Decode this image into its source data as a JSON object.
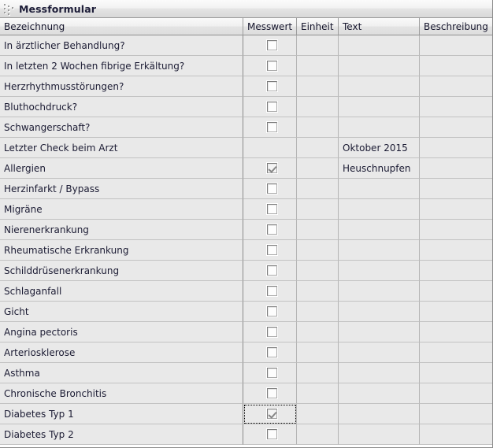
{
  "window": {
    "title": "Messformular",
    "grip_icon": "drag-grip-icon"
  },
  "colors": {
    "row_gray": "#e9e9e9",
    "row_white": "#ffffff",
    "focus_cell": "#fae3a6",
    "header_grad_top": "#fafafa",
    "header_grad_bottom": "#dedede",
    "border": "#b4b4b4"
  },
  "table": {
    "columns": [
      {
        "key": "bezeichnung",
        "label": "Bezeichnung"
      },
      {
        "key": "messwert",
        "label": "Messwert"
      },
      {
        "key": "einheit",
        "label": "Einheit"
      },
      {
        "key": "text",
        "label": "Text"
      },
      {
        "key": "beschreibung",
        "label": "Beschreibung"
      }
    ],
    "rows": [
      {
        "bezeichnung": "In ärztlicher Behandlung?",
        "checkbox": true,
        "checked": false,
        "einheit": "",
        "text": "",
        "beschreibung": ""
      },
      {
        "bezeichnung": "In letzten 2 Wochen fibrige Erkältung?",
        "checkbox": true,
        "checked": false,
        "einheit": "",
        "text": "",
        "beschreibung": ""
      },
      {
        "bezeichnung": "Herzrhythmusstörungen?",
        "checkbox": true,
        "checked": false,
        "einheit": "",
        "text": "",
        "beschreibung": ""
      },
      {
        "bezeichnung": "Bluthochdruck?",
        "checkbox": true,
        "checked": false,
        "einheit": "",
        "text": "",
        "beschreibung": ""
      },
      {
        "bezeichnung": "Schwangerschaft?",
        "checkbox": true,
        "checked": false,
        "einheit": "",
        "text": "",
        "beschreibung": ""
      },
      {
        "bezeichnung": "Letzter Check beim Arzt",
        "checkbox": false,
        "checked": false,
        "einheit": "",
        "text": "Oktober 2015",
        "beschreibung": ""
      },
      {
        "bezeichnung": "Allergien",
        "checkbox": true,
        "checked": true,
        "einheit": "",
        "text": "Heuschnupfen",
        "beschreibung": ""
      },
      {
        "bezeichnung": "Herzinfarkt / Bypass",
        "checkbox": true,
        "checked": false,
        "einheit": "",
        "text": "",
        "beschreibung": ""
      },
      {
        "bezeichnung": "Migräne",
        "checkbox": true,
        "checked": false,
        "einheit": "",
        "text": "",
        "beschreibung": ""
      },
      {
        "bezeichnung": "Nierenerkrankung",
        "checkbox": true,
        "checked": false,
        "einheit": "",
        "text": "",
        "beschreibung": ""
      },
      {
        "bezeichnung": "Rheumatische Erkrankung",
        "checkbox": true,
        "checked": false,
        "einheit": "",
        "text": "",
        "beschreibung": ""
      },
      {
        "bezeichnung": "Schilddrüsenerkrankung",
        "checkbox": true,
        "checked": false,
        "einheit": "",
        "text": "",
        "beschreibung": ""
      },
      {
        "bezeichnung": "Schlaganfall",
        "checkbox": true,
        "checked": false,
        "einheit": "",
        "text": "",
        "beschreibung": ""
      },
      {
        "bezeichnung": "Gicht",
        "checkbox": true,
        "checked": false,
        "einheit": "",
        "text": "",
        "beschreibung": ""
      },
      {
        "bezeichnung": "Angina pectoris",
        "checkbox": true,
        "checked": false,
        "einheit": "",
        "text": "",
        "beschreibung": ""
      },
      {
        "bezeichnung": "Arteriosklerose",
        "checkbox": true,
        "checked": false,
        "einheit": "",
        "text": "",
        "beschreibung": ""
      },
      {
        "bezeichnung": "Asthma",
        "checkbox": true,
        "checked": false,
        "einheit": "",
        "text": "",
        "beschreibung": ""
      },
      {
        "bezeichnung": "Chronische Bronchitis",
        "checkbox": true,
        "checked": false,
        "einheit": "",
        "text": "",
        "beschreibung": ""
      },
      {
        "bezeichnung": "Diabetes Typ 1",
        "checkbox": true,
        "checked": true,
        "einheit": "",
        "text": "",
        "beschreibung": "",
        "focused": true
      },
      {
        "bezeichnung": "Diabetes Typ 2",
        "checkbox": true,
        "checked": false,
        "einheit": "",
        "text": "",
        "beschreibung": ""
      }
    ]
  }
}
